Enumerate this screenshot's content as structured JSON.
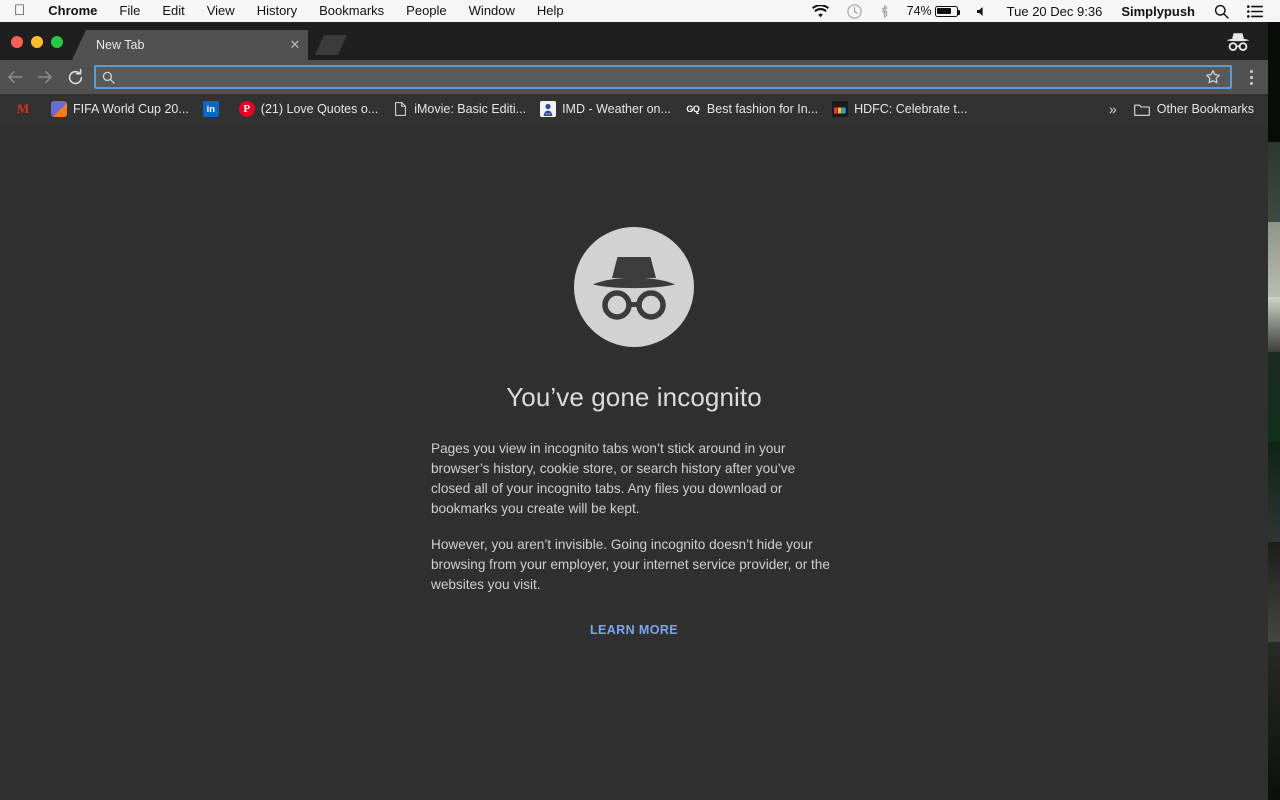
{
  "menubar": {
    "apple_glyph": "",
    "items": [
      {
        "label": "Chrome",
        "bold": true
      },
      {
        "label": "File",
        "bold": false
      },
      {
        "label": "Edit",
        "bold": false
      },
      {
        "label": "View",
        "bold": false
      },
      {
        "label": "History",
        "bold": false
      },
      {
        "label": "Bookmarks",
        "bold": false
      },
      {
        "label": "People",
        "bold": false
      },
      {
        "label": "Window",
        "bold": false
      },
      {
        "label": "Help",
        "bold": false
      }
    ],
    "status": {
      "wifi_icon": "wifi-icon",
      "timemachine_icon": "time-machine-icon",
      "bluetooth_icon": "bluetooth-icon",
      "battery_percent": "74%",
      "battery_icon": "battery-icon",
      "volume_icon": "volume-icon",
      "datetime": "Tue 20 Dec  9:36",
      "user": "Simplypush",
      "search_icon": "search-icon",
      "notification_icon": "notification-center-icon"
    }
  },
  "window": {
    "tab": {
      "title": "New Tab",
      "close_label": "✕"
    },
    "newtab_button_name": "new-tab-button",
    "incognito_badge_name": "incognito-indicator-icon"
  },
  "toolbar": {
    "back_icon": "back-arrow-icon",
    "forward_icon": "forward-arrow-icon",
    "reload_icon": "reload-icon",
    "omnibox": {
      "value": "",
      "placeholder": "",
      "search_icon": "search-icon",
      "star_icon": "bookmark-star-icon"
    },
    "menu_icon": "three-dot-menu-icon"
  },
  "bookmarks_bar": {
    "items": [
      {
        "label": "",
        "icon": "gmail-icon",
        "glyph": "M",
        "cls": "fav-gmail"
      },
      {
        "label": "FIFA World Cup 20...",
        "icon": "fifa-icon",
        "glyph": "",
        "cls": "fav-fifa"
      },
      {
        "label": "",
        "icon": "linkedin-icon",
        "glyph": "in",
        "cls": "fav-li"
      },
      {
        "label": "(21) Love Quotes o...",
        "icon": "pinterest-icon",
        "glyph": "P",
        "cls": "fav-pin"
      },
      {
        "label": "iMovie: Basic Editi...",
        "icon": "document-icon",
        "glyph": "὜B",
        "cls": "fav-doc"
      },
      {
        "label": "IMD - Weather on...",
        "icon": "imd-icon",
        "glyph": "",
        "cls": "fav-imd"
      },
      {
        "label": "Best fashion for In...",
        "icon": "gq-icon",
        "glyph": "GQ",
        "cls": "fav-gq"
      },
      {
        "label": "HDFC: Celebrate t...",
        "icon": "hdfc-icon",
        "glyph": "",
        "cls": "fav-hdfc"
      }
    ],
    "overflow_label": "»",
    "other_bookmarks_label": "Other Bookmarks",
    "folder_icon": "folder-icon"
  },
  "page": {
    "illustration_name": "incognito-hat-glasses-icon",
    "title": "You’ve gone incognito",
    "paragraph1": "Pages you view in incognito tabs won’t stick around in your browser’s history, cookie store, or search history after you’ve closed all of your incognito tabs. Any files you download or bookmarks you create will be kept.",
    "paragraph2": "However, you aren’t invisible. Going incognito doesn’t hide your browsing from your employer, your internet service provider, or the websites you visit.",
    "learn_more": "LEARN MORE"
  },
  "colors": {
    "page_bg": "#303030",
    "toolbar_bg": "#515151",
    "tabstrip_bg": "#1f1f1f",
    "bookmarks_bg": "#323232",
    "omnibox_focus": "#5b9bd5",
    "link": "#7ba7f0",
    "incognito_circle": "#d2d2d2"
  }
}
